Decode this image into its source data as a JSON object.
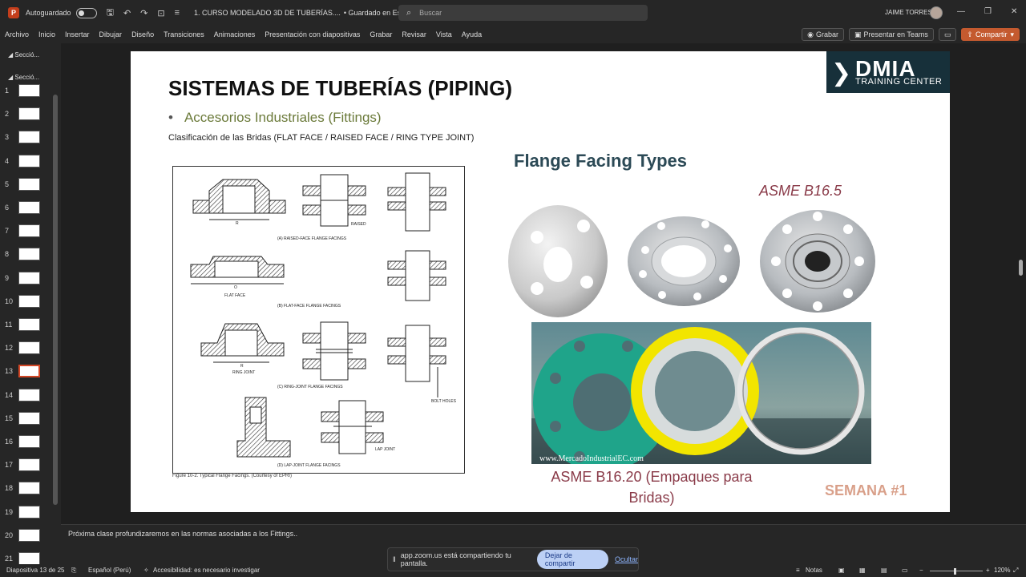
{
  "titlebar": {
    "autosave_label": "Autoguardado",
    "doc_title": "1. CURSO MODELADO 3D DE TUBERÍAS....",
    "save_state": "• Guardado en Este PC",
    "search_placeholder": "Buscar",
    "user_name": "JAIME TORRES"
  },
  "ribbon": {
    "menu": [
      "Archivo",
      "Inicio",
      "Insertar",
      "Dibujar",
      "Diseño",
      "Transiciones",
      "Animaciones",
      "Presentación con diapositivas",
      "Grabar",
      "Revisar",
      "Vista",
      "Ayuda"
    ],
    "record_label": "Grabar",
    "teams_label": "Presentar en Teams",
    "share_label": "Compartir"
  },
  "thumbnails": {
    "sections": [
      "Secció...",
      "Secció..."
    ],
    "numbers": [
      "1",
      "2",
      "3",
      "4",
      "5",
      "6",
      "7",
      "8",
      "9",
      "10",
      "11",
      "12",
      "13",
      "14",
      "15",
      "16",
      "17",
      "18",
      "19",
      "20",
      "21"
    ],
    "active": "13"
  },
  "slide": {
    "title": "SISTEMAS DE TUBERÍAS (PIPING)",
    "bullet": "Accesorios Industriales (Fittings)",
    "subtitle": "Clasificación de las Bridas (FLAT FACE / RAISED FACE / RING TYPE JOINT)",
    "logo_brand": "DMIA",
    "logo_tag": "TRAINING CENTER",
    "facing_title": "Flange Facing Types",
    "asme_b165": "ASME B16.5",
    "asme_b1620_line1": "ASME B16.20 (Empaques para",
    "asme_b1620_line2": "Bridas)",
    "semana": "SEMANA #1",
    "watermark": "www.MercadoIndustrialEC.com",
    "diagram": {
      "raised_label": "(A) RAISED-FACE FLANGE FACINGS",
      "flat_label": "(B) FLAT-FACE FLANGE FACINGS",
      "ring_label": "(C) RING-JOINT FLANGE FACINGS",
      "lap_label": "(D) LAP-JOINT FLANGE FACINGS",
      "raised": "RAISED",
      "flat_face": "FLAT FACE",
      "ring_joint": "RING JOINT",
      "bolt_holes": "BOLT HOLES",
      "lap_joint": "LAP JOINT",
      "r": "R",
      "o": "O",
      "caption": "Figure 10-2. Typical Flange Facings. (Courtesy of EPRI)"
    }
  },
  "notes": {
    "text": "Próxima clase profundizaremos en las normas asociadas a los Fittings.."
  },
  "statusbar": {
    "slide_count": "Diapositiva 13 de 25",
    "language": "Español (Perú)",
    "accessibility": "Accesibilidad: es necesario investigar",
    "notes_label": "Notas",
    "zoom": "120%"
  },
  "share_bar": {
    "message": "app.zoom.us está compartiendo tu pantalla.",
    "stop_label": "Dejar de compartir",
    "hide_label": "Ocultar"
  }
}
